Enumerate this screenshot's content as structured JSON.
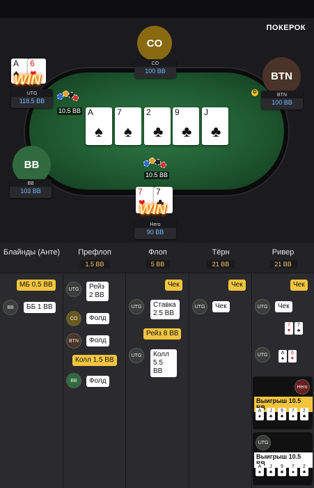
{
  "brand": "ПОКЕРОК",
  "seats": {
    "co": {
      "avatar": "CO",
      "name": "CO",
      "stack": "100 BB"
    },
    "btn": {
      "avatar": "BTN",
      "name": "BTN",
      "stack": "100 BB"
    },
    "utg": {
      "name": "UTG",
      "stack": "118.5 BB",
      "bet": "10.5 BB",
      "cards": [
        {
          "r": "A",
          "s": "♠"
        },
        {
          "r": "6",
          "s": "♥"
        }
      ]
    },
    "bb": {
      "avatar": "BB",
      "name": "BB",
      "stack": "103 BB"
    },
    "hero": {
      "name": "Hero",
      "stack": "90 BB",
      "cards": [
        {
          "r": "7",
          "s": "♥"
        },
        {
          "r": "7",
          "s": "♣"
        }
      ]
    }
  },
  "win_text": "WIN",
  "dealer": "D",
  "board": [
    {
      "r": "A",
      "s": "♠"
    },
    {
      "r": "7",
      "s": "♠"
    },
    {
      "r": "2",
      "s": "♣"
    },
    {
      "r": "9",
      "s": "♣"
    },
    {
      "r": "J",
      "s": "♣"
    }
  ],
  "pot": "10.5 BB",
  "columns": [
    {
      "title": "Блайнды (Анте)",
      "value": ""
    },
    {
      "title": "Префлоп",
      "value": "1.5 BB"
    },
    {
      "title": "Флоп",
      "value": "5 BB"
    },
    {
      "title": "Тёрн",
      "value": "21 BB"
    },
    {
      "title": "Ривер",
      "value": "21 BB"
    }
  ],
  "actions": {
    "blinds": {
      "sb": "МБ 0.5 BB",
      "bb_pos": "BB",
      "bb": "ББ 1 BB"
    },
    "preflop": {
      "utg_pos": "UTG",
      "utg": "Рейз 2 BB",
      "co_pos": "CO",
      "co": "Фолд",
      "btn_pos": "BTN",
      "btn": "Фолд",
      "call": "Колл 1.5 BB",
      "bb_pos": "BB",
      "bb": "Фолд"
    },
    "flop": {
      "check": "Чек",
      "utg_pos": "UTG",
      "utg": "Ставка 2.5 BB",
      "raise": "Рейз 8 BB",
      "utg2_pos": "UTG",
      "utg2": "Колл 5.5 BB"
    },
    "turn": {
      "check": "Чек",
      "utg_pos": "UTG",
      "utg": "Чек"
    },
    "river": {
      "check": "Чек",
      "utg_pos": "UTG",
      "utg": "Чек",
      "utg2_pos": "UTG",
      "hero_label": "Hero",
      "hero_result": "Выигрыш 10.5 BB",
      "utg_label": "UTG",
      "utg_result": "Выигрыш 10.5 BB"
    }
  },
  "river_hands": {
    "hero": [
      {
        "r": "7",
        "s": "♥",
        "c": "red"
      },
      {
        "r": "7",
        "s": "♣",
        "c": ""
      }
    ],
    "utg": [
      {
        "r": "A",
        "s": "♠",
        "c": ""
      },
      {
        "r": "6",
        "s": "♥",
        "c": "red"
      }
    ],
    "hero_best": [
      {
        "r": "A",
        "s": "♠"
      },
      {
        "r": "J",
        "s": "♣"
      },
      {
        "r": "9",
        "s": "♣"
      },
      {
        "r": "7",
        "s": "♠"
      },
      {
        "r": "2",
        "s": "♣"
      }
    ],
    "utg_best": [
      {
        "r": "A",
        "s": "♠"
      },
      {
        "r": "J",
        "s": "♣"
      },
      {
        "r": "9",
        "s": "♣"
      },
      {
        "r": "7",
        "s": "♠"
      },
      {
        "r": "2",
        "s": "♣"
      }
    ]
  }
}
